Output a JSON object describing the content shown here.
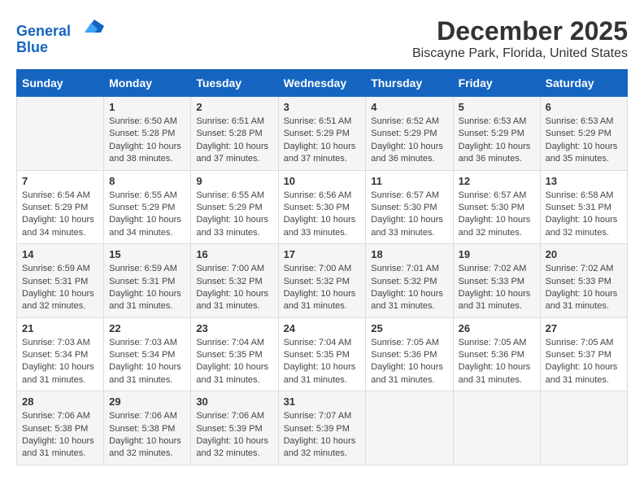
{
  "logo": {
    "line1": "General",
    "line2": "Blue"
  },
  "title": "December 2025",
  "subtitle": "Biscayne Park, Florida, United States",
  "headers": [
    "Sunday",
    "Monday",
    "Tuesday",
    "Wednesday",
    "Thursday",
    "Friday",
    "Saturday"
  ],
  "weeks": [
    [
      {
        "day": "",
        "sunrise": "",
        "sunset": "",
        "daylight": ""
      },
      {
        "day": "1",
        "sunrise": "Sunrise: 6:50 AM",
        "sunset": "Sunset: 5:28 PM",
        "daylight": "Daylight: 10 hours and 38 minutes."
      },
      {
        "day": "2",
        "sunrise": "Sunrise: 6:51 AM",
        "sunset": "Sunset: 5:28 PM",
        "daylight": "Daylight: 10 hours and 37 minutes."
      },
      {
        "day": "3",
        "sunrise": "Sunrise: 6:51 AM",
        "sunset": "Sunset: 5:29 PM",
        "daylight": "Daylight: 10 hours and 37 minutes."
      },
      {
        "day": "4",
        "sunrise": "Sunrise: 6:52 AM",
        "sunset": "Sunset: 5:29 PM",
        "daylight": "Daylight: 10 hours and 36 minutes."
      },
      {
        "day": "5",
        "sunrise": "Sunrise: 6:53 AM",
        "sunset": "Sunset: 5:29 PM",
        "daylight": "Daylight: 10 hours and 36 minutes."
      },
      {
        "day": "6",
        "sunrise": "Sunrise: 6:53 AM",
        "sunset": "Sunset: 5:29 PM",
        "daylight": "Daylight: 10 hours and 35 minutes."
      }
    ],
    [
      {
        "day": "7",
        "sunrise": "Sunrise: 6:54 AM",
        "sunset": "Sunset: 5:29 PM",
        "daylight": "Daylight: 10 hours and 34 minutes."
      },
      {
        "day": "8",
        "sunrise": "Sunrise: 6:55 AM",
        "sunset": "Sunset: 5:29 PM",
        "daylight": "Daylight: 10 hours and 34 minutes."
      },
      {
        "day": "9",
        "sunrise": "Sunrise: 6:55 AM",
        "sunset": "Sunset: 5:29 PM",
        "daylight": "Daylight: 10 hours and 33 minutes."
      },
      {
        "day": "10",
        "sunrise": "Sunrise: 6:56 AM",
        "sunset": "Sunset: 5:30 PM",
        "daylight": "Daylight: 10 hours and 33 minutes."
      },
      {
        "day": "11",
        "sunrise": "Sunrise: 6:57 AM",
        "sunset": "Sunset: 5:30 PM",
        "daylight": "Daylight: 10 hours and 33 minutes."
      },
      {
        "day": "12",
        "sunrise": "Sunrise: 6:57 AM",
        "sunset": "Sunset: 5:30 PM",
        "daylight": "Daylight: 10 hours and 32 minutes."
      },
      {
        "day": "13",
        "sunrise": "Sunrise: 6:58 AM",
        "sunset": "Sunset: 5:31 PM",
        "daylight": "Daylight: 10 hours and 32 minutes."
      }
    ],
    [
      {
        "day": "14",
        "sunrise": "Sunrise: 6:59 AM",
        "sunset": "Sunset: 5:31 PM",
        "daylight": "Daylight: 10 hours and 32 minutes."
      },
      {
        "day": "15",
        "sunrise": "Sunrise: 6:59 AM",
        "sunset": "Sunset: 5:31 PM",
        "daylight": "Daylight: 10 hours and 31 minutes."
      },
      {
        "day": "16",
        "sunrise": "Sunrise: 7:00 AM",
        "sunset": "Sunset: 5:32 PM",
        "daylight": "Daylight: 10 hours and 31 minutes."
      },
      {
        "day": "17",
        "sunrise": "Sunrise: 7:00 AM",
        "sunset": "Sunset: 5:32 PM",
        "daylight": "Daylight: 10 hours and 31 minutes."
      },
      {
        "day": "18",
        "sunrise": "Sunrise: 7:01 AM",
        "sunset": "Sunset: 5:32 PM",
        "daylight": "Daylight: 10 hours and 31 minutes."
      },
      {
        "day": "19",
        "sunrise": "Sunrise: 7:02 AM",
        "sunset": "Sunset: 5:33 PM",
        "daylight": "Daylight: 10 hours and 31 minutes."
      },
      {
        "day": "20",
        "sunrise": "Sunrise: 7:02 AM",
        "sunset": "Sunset: 5:33 PM",
        "daylight": "Daylight: 10 hours and 31 minutes."
      }
    ],
    [
      {
        "day": "21",
        "sunrise": "Sunrise: 7:03 AM",
        "sunset": "Sunset: 5:34 PM",
        "daylight": "Daylight: 10 hours and 31 minutes."
      },
      {
        "day": "22",
        "sunrise": "Sunrise: 7:03 AM",
        "sunset": "Sunset: 5:34 PM",
        "daylight": "Daylight: 10 hours and 31 minutes."
      },
      {
        "day": "23",
        "sunrise": "Sunrise: 7:04 AM",
        "sunset": "Sunset: 5:35 PM",
        "daylight": "Daylight: 10 hours and 31 minutes."
      },
      {
        "day": "24",
        "sunrise": "Sunrise: 7:04 AM",
        "sunset": "Sunset: 5:35 PM",
        "daylight": "Daylight: 10 hours and 31 minutes."
      },
      {
        "day": "25",
        "sunrise": "Sunrise: 7:05 AM",
        "sunset": "Sunset: 5:36 PM",
        "daylight": "Daylight: 10 hours and 31 minutes."
      },
      {
        "day": "26",
        "sunrise": "Sunrise: 7:05 AM",
        "sunset": "Sunset: 5:36 PM",
        "daylight": "Daylight: 10 hours and 31 minutes."
      },
      {
        "day": "27",
        "sunrise": "Sunrise: 7:05 AM",
        "sunset": "Sunset: 5:37 PM",
        "daylight": "Daylight: 10 hours and 31 minutes."
      }
    ],
    [
      {
        "day": "28",
        "sunrise": "Sunrise: 7:06 AM",
        "sunset": "Sunset: 5:38 PM",
        "daylight": "Daylight: 10 hours and 31 minutes."
      },
      {
        "day": "29",
        "sunrise": "Sunrise: 7:06 AM",
        "sunset": "Sunset: 5:38 PM",
        "daylight": "Daylight: 10 hours and 32 minutes."
      },
      {
        "day": "30",
        "sunrise": "Sunrise: 7:06 AM",
        "sunset": "Sunset: 5:39 PM",
        "daylight": "Daylight: 10 hours and 32 minutes."
      },
      {
        "day": "31",
        "sunrise": "Sunrise: 7:07 AM",
        "sunset": "Sunset: 5:39 PM",
        "daylight": "Daylight: 10 hours and 32 minutes."
      },
      {
        "day": "",
        "sunrise": "",
        "sunset": "",
        "daylight": ""
      },
      {
        "day": "",
        "sunrise": "",
        "sunset": "",
        "daylight": ""
      },
      {
        "day": "",
        "sunrise": "",
        "sunset": "",
        "daylight": ""
      }
    ]
  ]
}
